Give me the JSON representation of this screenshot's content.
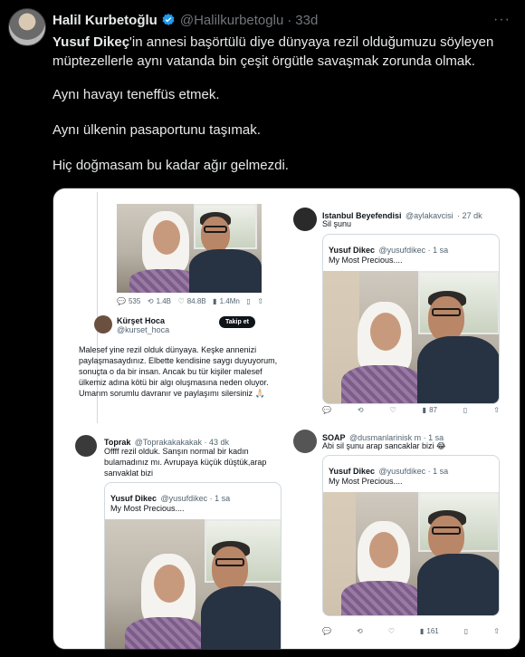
{
  "tweet": {
    "author_name": "Halil Kurbetoğlu",
    "handle": "@Halilkurbetoglu",
    "separator": "·",
    "time_ago": "33d",
    "more": "···",
    "mention": "Yusuf Dikeç",
    "line1_rest": "'in annesi başörtülü diye dünyaya rezil olduğumuzu söyleyen müptezellerle aynı vatanda bin çeşit örgütle savaşmak zorunda olmak.",
    "line2": "Aynı havayı teneffüs etmek.",
    "line3": "Aynı ülkenin pasaportunu taşımak.",
    "line4": "Hiç doğmasam bu kadar ağır gelmezdi."
  },
  "panel_a": {
    "stats": [
      "535",
      "1.4B",
      "84.8B",
      "1.4Mn",
      ""
    ],
    "author_name": "Kürşet Hoca",
    "handle": "@kurset_hoca",
    "follow_label": "Takip et",
    "text": "Malesef yine rezil olduk dünyaya. Keşke annenizi paylaşmasaydınız. Elbette kendisine saygı duyuyorum, sonuçta o da bir insan. Ancak bu tür kişiler malesef ülkemiz adına kötü bir algı oluşmasına neden oluyor. Umarım sorumlu davranır ve paylaşımı silersiniz 🙏🏻"
  },
  "panel_b": {
    "author_name": "Istanbul Beyefendisi",
    "handle": "@aylakavcisi",
    "time_ago": "· 27 dk",
    "text": "Sil şunu",
    "quote_name": "Yusuf Dikec",
    "quote_handle": "@yusufdikec · 1 sa",
    "quote_text": "My Most Precious....",
    "views": "87"
  },
  "panel_c": {
    "author_name": "Toprak",
    "handle": "@Toprakakakakak · 43 dk",
    "text": "Offff rezil olduk. Sanşın normal bir kadın bulamadınız mı. Avrupaya küçük düştük,arap sanvaklat bizi",
    "quote_name": "Yusuf Dikec",
    "quote_handle": "@yusufdikec · 1 sa",
    "quote_text": "My Most Precious...."
  },
  "panel_d": {
    "author_name": "SOAP",
    "handle": "@dusmanlarinisk m · 1 sa",
    "text": "Abi sil şunu arap sancaklar bizi 😂",
    "quote_name": "Yusuf Dikec",
    "quote_handle": "@yusufdikec · 1 sa",
    "quote_text": "My Most Precious....",
    "views": "161"
  },
  "colors": {
    "accent": "#1d9bf0",
    "background": "#000000",
    "text": "#e7e9ea",
    "muted": "#71767b"
  }
}
